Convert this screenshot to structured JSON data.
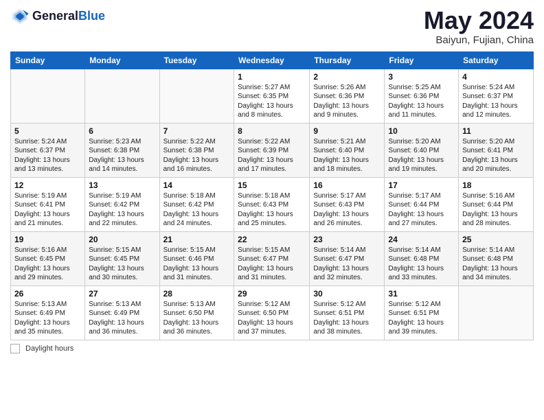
{
  "header": {
    "logo": {
      "general": "General",
      "blue": "Blue"
    },
    "title": "May 2024",
    "subtitle": "Baiyun, Fujian, China"
  },
  "weekdays": [
    "Sunday",
    "Monday",
    "Tuesday",
    "Wednesday",
    "Thursday",
    "Friday",
    "Saturday"
  ],
  "weeks": [
    [
      {
        "day": "",
        "info": ""
      },
      {
        "day": "",
        "info": ""
      },
      {
        "day": "",
        "info": ""
      },
      {
        "day": "1",
        "info": "Sunrise: 5:27 AM\nSunset: 6:35 PM\nDaylight: 13 hours\nand 8 minutes."
      },
      {
        "day": "2",
        "info": "Sunrise: 5:26 AM\nSunset: 6:36 PM\nDaylight: 13 hours\nand 9 minutes."
      },
      {
        "day": "3",
        "info": "Sunrise: 5:25 AM\nSunset: 6:36 PM\nDaylight: 13 hours\nand 11 minutes."
      },
      {
        "day": "4",
        "info": "Sunrise: 5:24 AM\nSunset: 6:37 PM\nDaylight: 13 hours\nand 12 minutes."
      }
    ],
    [
      {
        "day": "5",
        "info": "Sunrise: 5:24 AM\nSunset: 6:37 PM\nDaylight: 13 hours\nand 13 minutes."
      },
      {
        "day": "6",
        "info": "Sunrise: 5:23 AM\nSunset: 6:38 PM\nDaylight: 13 hours\nand 14 minutes."
      },
      {
        "day": "7",
        "info": "Sunrise: 5:22 AM\nSunset: 6:38 PM\nDaylight: 13 hours\nand 16 minutes."
      },
      {
        "day": "8",
        "info": "Sunrise: 5:22 AM\nSunset: 6:39 PM\nDaylight: 13 hours\nand 17 minutes."
      },
      {
        "day": "9",
        "info": "Sunrise: 5:21 AM\nSunset: 6:40 PM\nDaylight: 13 hours\nand 18 minutes."
      },
      {
        "day": "10",
        "info": "Sunrise: 5:20 AM\nSunset: 6:40 PM\nDaylight: 13 hours\nand 19 minutes."
      },
      {
        "day": "11",
        "info": "Sunrise: 5:20 AM\nSunset: 6:41 PM\nDaylight: 13 hours\nand 20 minutes."
      }
    ],
    [
      {
        "day": "12",
        "info": "Sunrise: 5:19 AM\nSunset: 6:41 PM\nDaylight: 13 hours\nand 21 minutes."
      },
      {
        "day": "13",
        "info": "Sunrise: 5:19 AM\nSunset: 6:42 PM\nDaylight: 13 hours\nand 22 minutes."
      },
      {
        "day": "14",
        "info": "Sunrise: 5:18 AM\nSunset: 6:42 PM\nDaylight: 13 hours\nand 24 minutes."
      },
      {
        "day": "15",
        "info": "Sunrise: 5:18 AM\nSunset: 6:43 PM\nDaylight: 13 hours\nand 25 minutes."
      },
      {
        "day": "16",
        "info": "Sunrise: 5:17 AM\nSunset: 6:43 PM\nDaylight: 13 hours\nand 26 minutes."
      },
      {
        "day": "17",
        "info": "Sunrise: 5:17 AM\nSunset: 6:44 PM\nDaylight: 13 hours\nand 27 minutes."
      },
      {
        "day": "18",
        "info": "Sunrise: 5:16 AM\nSunset: 6:44 PM\nDaylight: 13 hours\nand 28 minutes."
      }
    ],
    [
      {
        "day": "19",
        "info": "Sunrise: 5:16 AM\nSunset: 6:45 PM\nDaylight: 13 hours\nand 29 minutes."
      },
      {
        "day": "20",
        "info": "Sunrise: 5:15 AM\nSunset: 6:45 PM\nDaylight: 13 hours\nand 30 minutes."
      },
      {
        "day": "21",
        "info": "Sunrise: 5:15 AM\nSunset: 6:46 PM\nDaylight: 13 hours\nand 31 minutes."
      },
      {
        "day": "22",
        "info": "Sunrise: 5:15 AM\nSunset: 6:47 PM\nDaylight: 13 hours\nand 31 minutes."
      },
      {
        "day": "23",
        "info": "Sunrise: 5:14 AM\nSunset: 6:47 PM\nDaylight: 13 hours\nand 32 minutes."
      },
      {
        "day": "24",
        "info": "Sunrise: 5:14 AM\nSunset: 6:48 PM\nDaylight: 13 hours\nand 33 minutes."
      },
      {
        "day": "25",
        "info": "Sunrise: 5:14 AM\nSunset: 6:48 PM\nDaylight: 13 hours\nand 34 minutes."
      }
    ],
    [
      {
        "day": "26",
        "info": "Sunrise: 5:13 AM\nSunset: 6:49 PM\nDaylight: 13 hours\nand 35 minutes."
      },
      {
        "day": "27",
        "info": "Sunrise: 5:13 AM\nSunset: 6:49 PM\nDaylight: 13 hours\nand 36 minutes."
      },
      {
        "day": "28",
        "info": "Sunrise: 5:13 AM\nSunset: 6:50 PM\nDaylight: 13 hours\nand 36 minutes."
      },
      {
        "day": "29",
        "info": "Sunrise: 5:12 AM\nSunset: 6:50 PM\nDaylight: 13 hours\nand 37 minutes."
      },
      {
        "day": "30",
        "info": "Sunrise: 5:12 AM\nSunset: 6:51 PM\nDaylight: 13 hours\nand 38 minutes."
      },
      {
        "day": "31",
        "info": "Sunrise: 5:12 AM\nSunset: 6:51 PM\nDaylight: 13 hours\nand 39 minutes."
      },
      {
        "day": "",
        "info": ""
      }
    ]
  ],
  "footer": {
    "legend_label": "Daylight hours"
  }
}
